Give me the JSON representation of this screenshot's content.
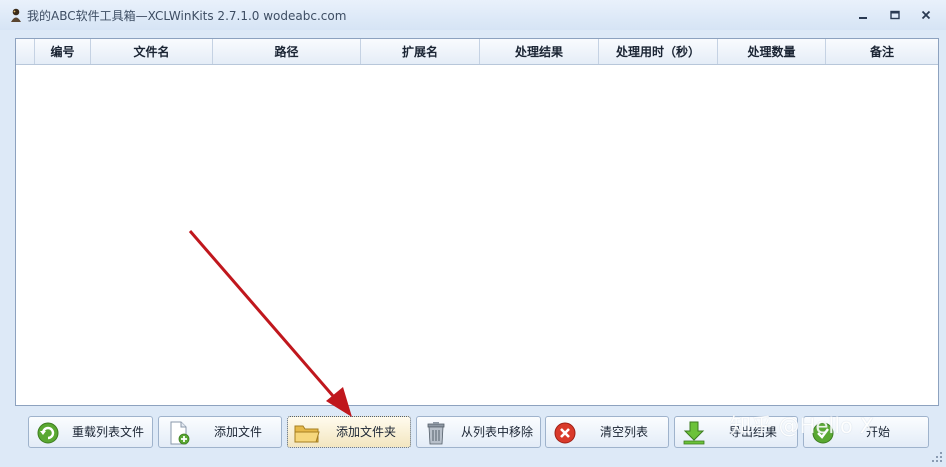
{
  "window": {
    "title": "我的ABC软件工具箱—XCLWinKits 2.7.1.0  wodeabc.com",
    "controls": [
      "minimize-icon",
      "maximize-icon",
      "close-icon"
    ]
  },
  "grid": {
    "columns": [
      "",
      "编号",
      "文件名",
      "路径",
      "扩展名",
      "处理结果",
      "处理用时（秒）",
      "处理数量",
      "备注"
    ],
    "rows": []
  },
  "toolbar": {
    "buttons": [
      {
        "label": "重载列表文件",
        "icon": "reload-icon"
      },
      {
        "label": "添加文件",
        "icon": "add-file-icon"
      },
      {
        "label": "添加文件夹",
        "icon": "folder-icon"
      },
      {
        "label": "从列表中移除",
        "icon": "trash-icon"
      },
      {
        "label": "清空列表",
        "icon": "clear-icon"
      },
      {
        "label": "导出结果",
        "icon": "export-icon"
      },
      {
        "label": "开始",
        "icon": "start-icon"
      }
    ]
  },
  "watermark": "知乎 @Hello X",
  "colors": {
    "accent": "#c0171d",
    "frame": "#8da2bf",
    "window_bg": "#dde9f7"
  }
}
